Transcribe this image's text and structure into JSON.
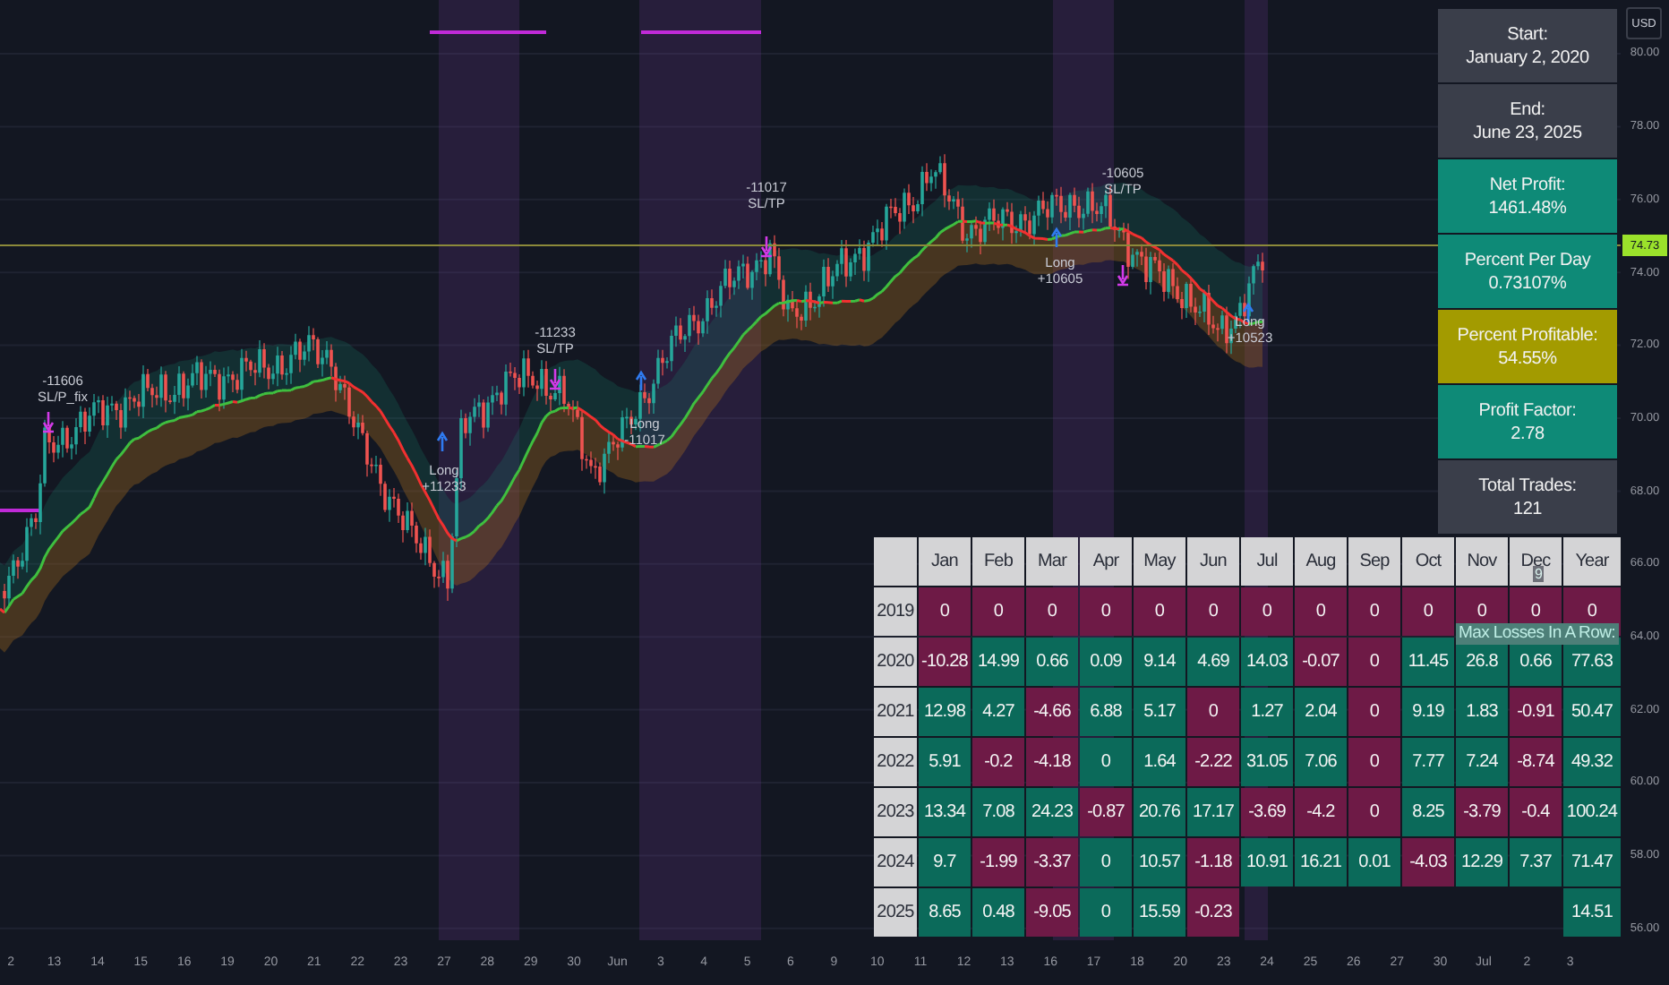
{
  "price_axis": {
    "currency": "USD",
    "ticks": [
      "80.00",
      "78.00",
      "76.00",
      "74.00",
      "72.00",
      "70.00",
      "68.00",
      "66.00",
      "64.00",
      "62.00",
      "60.00",
      "58.00",
      "56.00"
    ],
    "last_price": "74.73"
  },
  "time_axis": {
    "labels": [
      "2",
      "13",
      "14",
      "15",
      "16",
      "19",
      "20",
      "21",
      "22",
      "23",
      "27",
      "28",
      "29",
      "30",
      "Jun",
      "3",
      "4",
      "5",
      "6",
      "9",
      "10",
      "11",
      "12",
      "13",
      "16",
      "17",
      "18",
      "20",
      "23",
      "24",
      "25",
      "26",
      "27",
      "30",
      "Jul",
      "2",
      "3"
    ]
  },
  "trade_labels": [
    {
      "lines": [
        "-11606",
        "SL/P_fix"
      ]
    },
    {
      "lines": [
        "-11233",
        "SL/TP"
      ]
    },
    {
      "lines": [
        "Long",
        "+11233"
      ]
    },
    {
      "lines": [
        "-11017",
        "SL/TP"
      ]
    },
    {
      "lines": [
        "Long",
        "-11017"
      ]
    },
    {
      "lines": [
        "-10605",
        "SL/TP"
      ]
    },
    {
      "lines": [
        "Long",
        "+10605"
      ]
    },
    {
      "lines": [
        "Long",
        "+10523"
      ]
    }
  ],
  "stats": [
    {
      "label": "Start:",
      "value": "January 2, 2020",
      "color": "#3a3e4a"
    },
    {
      "label": "End:",
      "value": "June 23, 2025",
      "color": "#3a3e4a"
    },
    {
      "label": "Net Profit:",
      "value": "1461.48%",
      "color": "#0e8a77"
    },
    {
      "label": "Percent Per Day",
      "value": "0.73107%",
      "color": "#0e8a77"
    },
    {
      "label": "Percent Profitable:",
      "value": "54.55%",
      "color": "#a39b00"
    },
    {
      "label": "Profit Factor:",
      "value": "2.78",
      "color": "#0e8a77"
    },
    {
      "label": "Total Trades:",
      "value": "121",
      "color": "#3a3e4a"
    }
  ],
  "max_losses": {
    "label": "Max Losses In A Row:",
    "value": "9"
  },
  "monthly_table": {
    "columns": [
      "Jan",
      "Feb",
      "Mar",
      "Apr",
      "May",
      "Jun",
      "Jul",
      "Aug",
      "Sep",
      "Oct",
      "Nov",
      "Dec",
      "Year"
    ],
    "rows": [
      {
        "year": "2019",
        "months": [
          {
            "value": "0",
            "color": "#6e1a46"
          },
          {
            "value": "0",
            "color": "#6e1a46"
          },
          {
            "value": "0",
            "color": "#6e1a46"
          },
          {
            "value": "0",
            "color": "#6e1a46"
          },
          {
            "value": "0",
            "color": "#6e1a46"
          },
          {
            "value": "0",
            "color": "#6e1a46"
          },
          {
            "value": "0",
            "color": "#6e1a46"
          },
          {
            "value": "0",
            "color": "#6e1a46"
          },
          {
            "value": "0",
            "color": "#6e1a46"
          },
          {
            "value": "0",
            "color": "#6e1a46"
          },
          {
            "value": "0",
            "color": "#6e1a46"
          },
          {
            "value": "0",
            "color": "#6e1a46"
          }
        ],
        "total": {
          "value": "0",
          "color": "#6e1a46"
        }
      },
      {
        "year": "2020",
        "months": [
          {
            "value": "-10.28",
            "color": "#6e1a46"
          },
          {
            "value": "14.99",
            "color": "#0b6a5a"
          },
          {
            "value": "0.66",
            "color": "#0b6a5a"
          },
          {
            "value": "0.09",
            "color": "#0b6a5a"
          },
          {
            "value": "9.14",
            "color": "#0b6a5a"
          },
          {
            "value": "4.69",
            "color": "#0b6a5a"
          },
          {
            "value": "14.03",
            "color": "#0b6a5a"
          },
          {
            "value": "-0.07",
            "color": "#6e1a46"
          },
          {
            "value": "0",
            "color": "#6e1a46"
          },
          {
            "value": "11.45",
            "color": "#0b6a5a"
          },
          {
            "value": "26.8",
            "color": "#0b6a5a"
          },
          {
            "value": "0.66",
            "color": "#0b6a5a"
          }
        ],
        "total": {
          "value": "77.63",
          "color": "#0b6a5a"
        }
      },
      {
        "year": "2021",
        "months": [
          {
            "value": "12.98",
            "color": "#0b6a5a"
          },
          {
            "value": "4.27",
            "color": "#0b6a5a"
          },
          {
            "value": "-4.66",
            "color": "#6e1a46"
          },
          {
            "value": "6.88",
            "color": "#0b6a5a"
          },
          {
            "value": "5.17",
            "color": "#0b6a5a"
          },
          {
            "value": "0",
            "color": "#6e1a46"
          },
          {
            "value": "1.27",
            "color": "#0b6a5a"
          },
          {
            "value": "2.04",
            "color": "#0b6a5a"
          },
          {
            "value": "0",
            "color": "#6e1a46"
          },
          {
            "value": "9.19",
            "color": "#0b6a5a"
          },
          {
            "value": "1.83",
            "color": "#0b6a5a"
          },
          {
            "value": "-0.91",
            "color": "#6e1a46"
          }
        ],
        "total": {
          "value": "50.47",
          "color": "#0b6a5a"
        }
      },
      {
        "year": "2022",
        "months": [
          {
            "value": "5.91",
            "color": "#0b6a5a"
          },
          {
            "value": "-0.2",
            "color": "#6e1a46"
          },
          {
            "value": "-4.18",
            "color": "#6e1a46"
          },
          {
            "value": "0",
            "color": "#0b6a5a"
          },
          {
            "value": "1.64",
            "color": "#0b6a5a"
          },
          {
            "value": "-2.22",
            "color": "#6e1a46"
          },
          {
            "value": "31.05",
            "color": "#0b6a5a"
          },
          {
            "value": "7.06",
            "color": "#0b6a5a"
          },
          {
            "value": "0",
            "color": "#6e1a46"
          },
          {
            "value": "7.77",
            "color": "#0b6a5a"
          },
          {
            "value": "7.24",
            "color": "#0b6a5a"
          },
          {
            "value": "-8.74",
            "color": "#6e1a46"
          }
        ],
        "total": {
          "value": "49.32",
          "color": "#0b6a5a"
        }
      },
      {
        "year": "2023",
        "months": [
          {
            "value": "13.34",
            "color": "#0b6a5a"
          },
          {
            "value": "7.08",
            "color": "#0b6a5a"
          },
          {
            "value": "24.23",
            "color": "#0b6a5a"
          },
          {
            "value": "-0.87",
            "color": "#6e1a46"
          },
          {
            "value": "20.76",
            "color": "#0b6a5a"
          },
          {
            "value": "17.17",
            "color": "#0b6a5a"
          },
          {
            "value": "-3.69",
            "color": "#6e1a46"
          },
          {
            "value": "-4.2",
            "color": "#6e1a46"
          },
          {
            "value": "0",
            "color": "#6e1a46"
          },
          {
            "value": "8.25",
            "color": "#0b6a5a"
          },
          {
            "value": "-3.79",
            "color": "#6e1a46"
          },
          {
            "value": "-0.4",
            "color": "#6e1a46"
          }
        ],
        "total": {
          "value": "100.24",
          "color": "#0b6a5a"
        }
      },
      {
        "year": "2024",
        "months": [
          {
            "value": "9.7",
            "color": "#0b6a5a"
          },
          {
            "value": "-1.99",
            "color": "#6e1a46"
          },
          {
            "value": "-3.37",
            "color": "#6e1a46"
          },
          {
            "value": "0",
            "color": "#0b6a5a"
          },
          {
            "value": "10.57",
            "color": "#0b6a5a"
          },
          {
            "value": "-1.18",
            "color": "#6e1a46"
          },
          {
            "value": "10.91",
            "color": "#0b6a5a"
          },
          {
            "value": "16.21",
            "color": "#0b6a5a"
          },
          {
            "value": "0.01",
            "color": "#0b6a5a"
          },
          {
            "value": "-4.03",
            "color": "#6e1a46"
          },
          {
            "value": "12.29",
            "color": "#0b6a5a"
          },
          {
            "value": "7.37",
            "color": "#0b6a5a"
          }
        ],
        "total": {
          "value": "71.47",
          "color": "#0b6a5a"
        }
      },
      {
        "year": "2025",
        "months": [
          {
            "value": "8.65",
            "color": "#0b6a5a"
          },
          {
            "value": "0.48",
            "color": "#0b6a5a"
          },
          {
            "value": "-9.05",
            "color": "#6e1a46"
          },
          {
            "value": "0",
            "color": "#0b6a5a"
          },
          {
            "value": "15.59",
            "color": "#0b6a5a"
          },
          {
            "value": "-0.23",
            "color": "#6e1a46"
          }
        ],
        "total": {
          "value": "14.51",
          "color": "#0b6a5a"
        }
      }
    ]
  }
}
